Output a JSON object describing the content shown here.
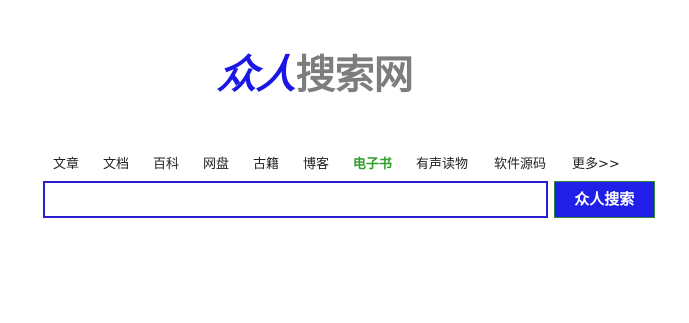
{
  "logo": {
    "part1": "众人",
    "part2": "搜索网"
  },
  "nav": {
    "items": [
      {
        "label": "文章"
      },
      {
        "label": "文档"
      },
      {
        "label": "百科"
      },
      {
        "label": "网盘"
      },
      {
        "label": "古籍"
      },
      {
        "label": "博客"
      },
      {
        "label": "电子书",
        "active": true
      },
      {
        "label": "有声读物"
      },
      {
        "label": "软件源码"
      },
      {
        "label": "更多>>"
      }
    ]
  },
  "search": {
    "value": "",
    "placeholder": "",
    "button_label": "众人搜索"
  },
  "colors": {
    "accent": "#1f1fe8",
    "active_tab": "#2f9e2a",
    "logo_gray": "#7d7d7d"
  }
}
